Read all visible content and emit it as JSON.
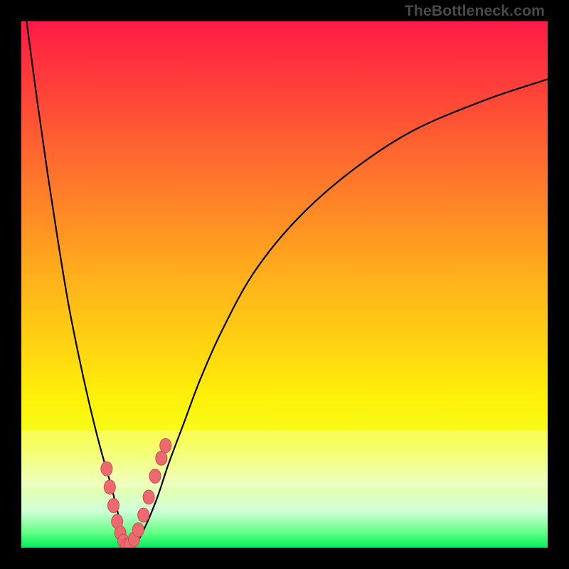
{
  "attribution": "TheBottleneck.com",
  "colors": {
    "frame": "#000000",
    "curve": "#000000",
    "marker_fill": "#ec6a6f",
    "marker_stroke": "#c94d54",
    "gradient_top": "#ff1a47",
    "gradient_bottom": "#00ef5b"
  },
  "chart_data": {
    "type": "line",
    "title": "",
    "xlabel": "",
    "ylabel": "",
    "xlim": [
      0,
      100
    ],
    "ylim": [
      0,
      100
    ],
    "grid": false,
    "series": [
      {
        "name": "bottleneck-curve",
        "x": [
          1,
          3,
          5,
          7,
          9,
          11,
          13,
          15,
          17,
          18,
          19,
          20,
          21,
          22,
          24,
          26,
          28,
          31,
          34,
          38,
          44,
          52,
          62,
          74,
          88,
          100
        ],
        "y": [
          100,
          85,
          71,
          58,
          46,
          36,
          27,
          19,
          12,
          8,
          4,
          1,
          0,
          1,
          5,
          10,
          16,
          24,
          32,
          41,
          52,
          62,
          71,
          79,
          85,
          89
        ]
      }
    ],
    "markers": {
      "name": "highlighted-points",
      "x": [
        16.2,
        16.8,
        17.5,
        18.2,
        18.8,
        19.4,
        20.0,
        20.6,
        21.4,
        22.2,
        23.2,
        24.2,
        25.4,
        26.6,
        27.4
      ],
      "y": [
        15.0,
        11.5,
        8.0,
        5.0,
        2.8,
        1.2,
        0.4,
        0.6,
        1.6,
        3.4,
        6.2,
        9.6,
        13.6,
        17.0,
        19.4
      ]
    }
  }
}
